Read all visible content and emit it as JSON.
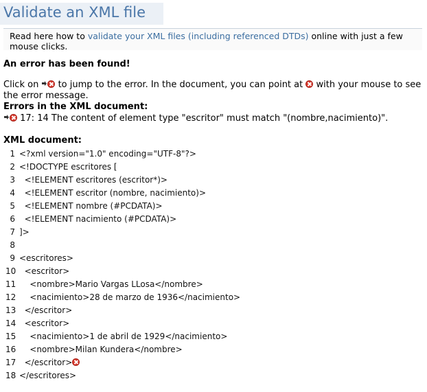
{
  "header": {
    "title": "Validate an XML file"
  },
  "intro": {
    "prefix": "Read here how to ",
    "link": "validate your XML files (including referenced DTDs)",
    "suffix": " online with just a few mouse clicks."
  },
  "status": {
    "error_found": "An error has been found!"
  },
  "instructions": {
    "part1": "Click on ",
    "part2": " to jump to the error. In the document, you can point at ",
    "part3": " with your mouse to see the error message."
  },
  "errors": {
    "heading": "Errors in the XML document:",
    "items": [
      {
        "location": "17: 14",
        "message": "The content of element type \"escritor\" must match \"(nombre,nacimiento)\"."
      }
    ]
  },
  "document": {
    "heading": "XML document:",
    "lines": [
      {
        "num": "1",
        "text": "<?xml version=\"1.0\" encoding=\"UTF-8\"?>"
      },
      {
        "num": "2",
        "text": "<!DOCTYPE escritores ["
      },
      {
        "num": "3",
        "text": "  <!ELEMENT escritores (escritor*)>"
      },
      {
        "num": "4",
        "text": "  <!ELEMENT escritor (nombre, nacimiento)>"
      },
      {
        "num": "5",
        "text": "  <!ELEMENT nombre (#PCDATA)>"
      },
      {
        "num": "6",
        "text": "  <!ELEMENT nacimiento (#PCDATA)>"
      },
      {
        "num": "7",
        "text": "]>"
      },
      {
        "num": "8",
        "text": ""
      },
      {
        "num": "9",
        "text": "<escritores>"
      },
      {
        "num": "10",
        "text": "  <escritor>"
      },
      {
        "num": "11",
        "text": "    <nombre>Mario Vargas LLosa</nombre>"
      },
      {
        "num": "12",
        "text": "    <nacimiento>28 de marzo de 1936</nacimiento>"
      },
      {
        "num": "13",
        "text": "  </escritor>"
      },
      {
        "num": "14",
        "text": "  <escritor>"
      },
      {
        "num": "15",
        "text": "    <nacimiento>1 de abril de 1929</nacimiento>"
      },
      {
        "num": "16",
        "text": "    <nombre>Milan Kundera</nombre>"
      },
      {
        "num": "17",
        "text": "  </escritor>",
        "error": true
      },
      {
        "num": "18",
        "text": "</escritores>"
      }
    ]
  },
  "colors": {
    "title": "#4a76a8",
    "link": "#3a6da0",
    "error": "#d93a2e"
  }
}
